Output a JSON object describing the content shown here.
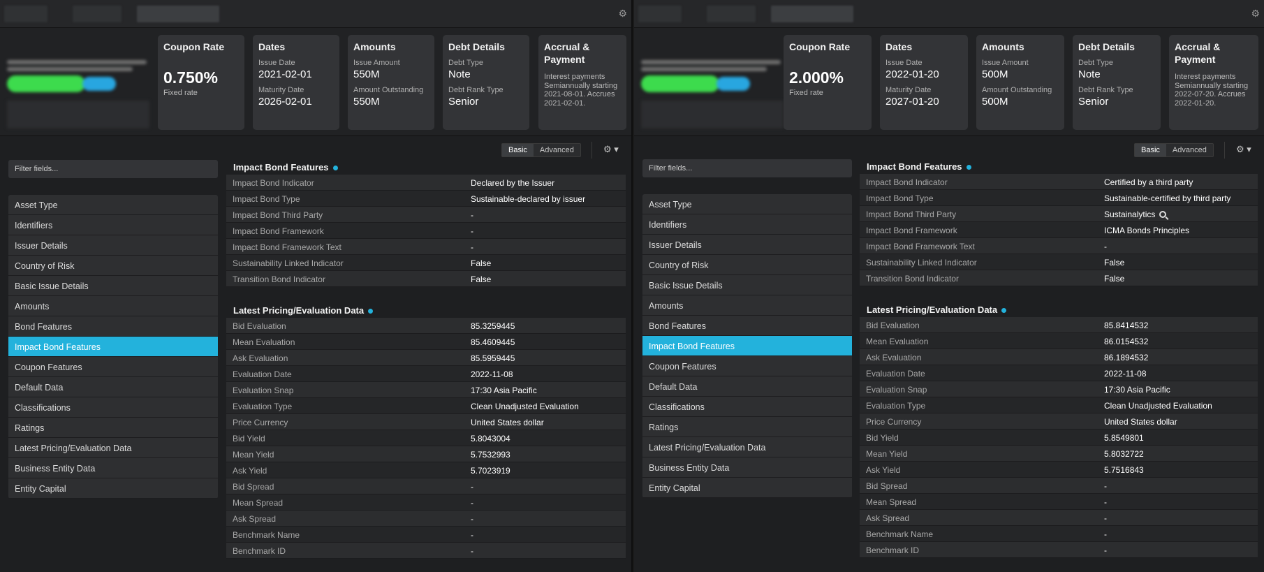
{
  "left": {
    "coupon": {
      "title": "Coupon Rate",
      "value": "0.750%",
      "note": "Fixed rate"
    },
    "dates": {
      "title": "Dates",
      "issue_label": "Issue Date",
      "issue": "2021-02-01",
      "maturity_label": "Maturity Date",
      "maturity": "2026-02-01"
    },
    "amounts": {
      "title": "Amounts",
      "issue_label": "Issue Amount",
      "issue": "550M",
      "outstanding_label": "Amount Outstanding",
      "outstanding": "550M"
    },
    "debt": {
      "title": "Debt Details",
      "type_label": "Debt Type",
      "type": "Note",
      "rank_label": "Debt Rank Type",
      "rank": "Senior"
    },
    "accrual": {
      "title": "Accrual & Payment",
      "text": "Interest payments Semiannually starting 2021-08-01. Accrues 2021-02-01."
    },
    "impact_rows": [
      [
        "Impact Bond Indicator",
        "Declared by the Issuer"
      ],
      [
        "Impact Bond Type",
        "Sustainable-declared by issuer"
      ],
      [
        "Impact Bond Third Party",
        "-"
      ],
      [
        "Impact Bond Framework",
        "-"
      ],
      [
        "Impact Bond Framework Text",
        "-"
      ],
      [
        "Sustainability Linked Indicator",
        "False"
      ],
      [
        "Transition Bond Indicator",
        "False"
      ]
    ],
    "pricing_rows": [
      [
        "Bid Evaluation",
        "85.3259445"
      ],
      [
        "Mean Evaluation",
        "85.4609445"
      ],
      [
        "Ask Evaluation",
        "85.5959445"
      ],
      [
        "Evaluation Date",
        "2022-11-08"
      ],
      [
        "Evaluation Snap",
        "17:30 Asia Pacific"
      ],
      [
        "Evaluation Type",
        "Clean Unadjusted Evaluation"
      ],
      [
        "Price Currency",
        "United States dollar"
      ],
      [
        "Bid Yield",
        "5.8043004"
      ],
      [
        "Mean Yield",
        "5.7532993"
      ],
      [
        "Ask Yield",
        "5.7023919"
      ],
      [
        "Bid Spread",
        "-"
      ],
      [
        "Mean Spread",
        "-"
      ],
      [
        "Ask Spread",
        "-"
      ],
      [
        "Benchmark Name",
        "-"
      ],
      [
        "Benchmark ID",
        "-"
      ]
    ]
  },
  "right": {
    "coupon": {
      "title": "Coupon Rate",
      "value": "2.000%",
      "note": "Fixed rate"
    },
    "dates": {
      "title": "Dates",
      "issue_label": "Issue Date",
      "issue": "2022-01-20",
      "maturity_label": "Maturity Date",
      "maturity": "2027-01-20"
    },
    "amounts": {
      "title": "Amounts",
      "issue_label": "Issue Amount",
      "issue": "500M",
      "outstanding_label": "Amount Outstanding",
      "outstanding": "500M"
    },
    "debt": {
      "title": "Debt Details",
      "type_label": "Debt Type",
      "type": "Note",
      "rank_label": "Debt Rank Type",
      "rank": "Senior"
    },
    "accrual": {
      "title": "Accrual & Payment",
      "text": "Interest payments Semiannually starting 2022-07-20. Accrues 2022-01-20."
    },
    "impact_rows": [
      [
        "Impact Bond Indicator",
        "Certified by a third party"
      ],
      [
        "Impact Bond Type",
        "Sustainable-certified by third party"
      ],
      [
        "Impact Bond Third Party",
        "Sustainalytics"
      ],
      [
        "Impact Bond Framework",
        "ICMA Bonds Principles"
      ],
      [
        "Impact Bond Framework Text",
        "-"
      ],
      [
        "Sustainability Linked Indicator",
        "False"
      ],
      [
        "Transition Bond Indicator",
        "False"
      ]
    ],
    "pricing_rows": [
      [
        "Bid Evaluation",
        "85.8414532"
      ],
      [
        "Mean Evaluation",
        "86.0154532"
      ],
      [
        "Ask Evaluation",
        "86.1894532"
      ],
      [
        "Evaluation Date",
        "2022-11-08"
      ],
      [
        "Evaluation Snap",
        "17:30 Asia Pacific"
      ],
      [
        "Evaluation Type",
        "Clean Unadjusted Evaluation"
      ],
      [
        "Price Currency",
        "United States dollar"
      ],
      [
        "Bid Yield",
        "5.8549801"
      ],
      [
        "Mean Yield",
        "5.8032722"
      ],
      [
        "Ask Yield",
        "5.7516843"
      ],
      [
        "Bid Spread",
        "-"
      ],
      [
        "Mean Spread",
        "-"
      ],
      [
        "Ask Spread",
        "-"
      ],
      [
        "Benchmark Name",
        "-"
      ],
      [
        "Benchmark ID",
        "-"
      ]
    ]
  },
  "shared": {
    "view_basic": "Basic",
    "view_advanced": "Advanced",
    "filter_placeholder": "Filter fields...",
    "impact_title": "Impact Bond Features",
    "pricing_title": "Latest Pricing/Evaluation Data",
    "nav": [
      "Asset Type",
      "Identifiers",
      "Issuer Details",
      "Country of Risk",
      "Basic Issue Details",
      "Amounts",
      "Bond Features",
      "Impact Bond Features",
      "Coupon Features",
      "Default Data",
      "Classifications",
      "Ratings",
      "Latest Pricing/Evaluation Data",
      "Business Entity Data",
      "Entity Capital"
    ],
    "active_nav": "Impact Bond Features",
    "accent": "#23b2dc",
    "gear_icon": "gear-icon",
    "search_icon": "magnifier-icon"
  }
}
